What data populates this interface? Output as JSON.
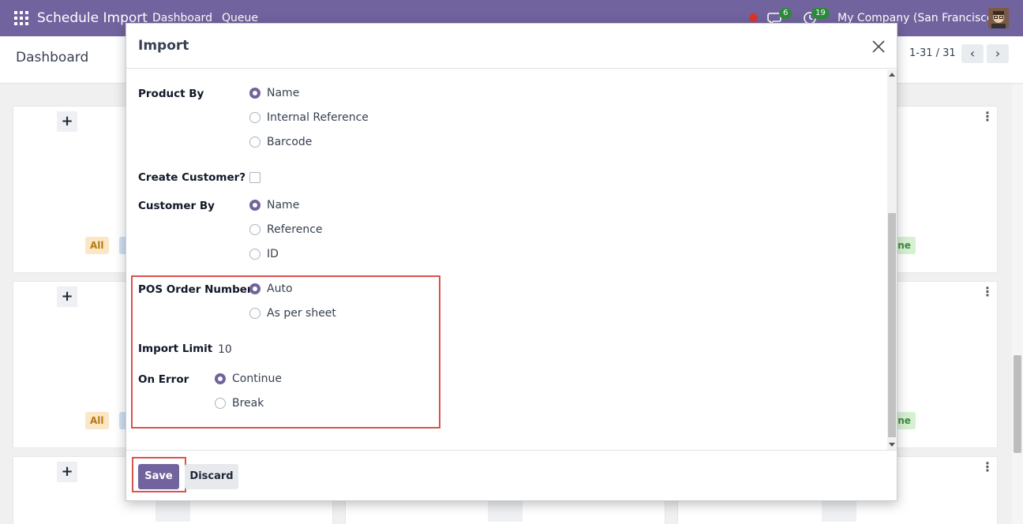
{
  "navbar": {
    "app_name": "Schedule Import",
    "menu": [
      "Dashboard",
      "Queue"
    ],
    "messages_count": "6",
    "activities_count": "19",
    "company": "My Company (San Francisco)"
  },
  "control_panel": {
    "title": "Dashboard",
    "pager": "1-31 / 31"
  },
  "kanban": {
    "tag_all": "All",
    "tag_done": "one"
  },
  "modal": {
    "title": "Import",
    "fields": {
      "product_by": {
        "label": "Product By",
        "options": [
          "Name",
          "Internal Reference",
          "Barcode"
        ],
        "selected": "Name"
      },
      "create_customer": {
        "label": "Create Customer?",
        "checked": false
      },
      "customer_by": {
        "label": "Customer By",
        "options": [
          "Name",
          "Reference",
          "ID"
        ],
        "selected": "Name"
      },
      "pos_order_number": {
        "label": "POS Order Number",
        "options": [
          "Auto",
          "As per sheet"
        ],
        "selected": "Auto"
      },
      "import_limit": {
        "label": "Import Limit",
        "value": "10"
      },
      "on_error": {
        "label": "On Error",
        "options": [
          "Continue",
          "Break"
        ],
        "selected": "Continue"
      }
    },
    "footer": {
      "save_label": "Save",
      "discard_label": "Discard"
    }
  },
  "colors": {
    "brand": "#71639e",
    "highlight": "#d9534f"
  }
}
